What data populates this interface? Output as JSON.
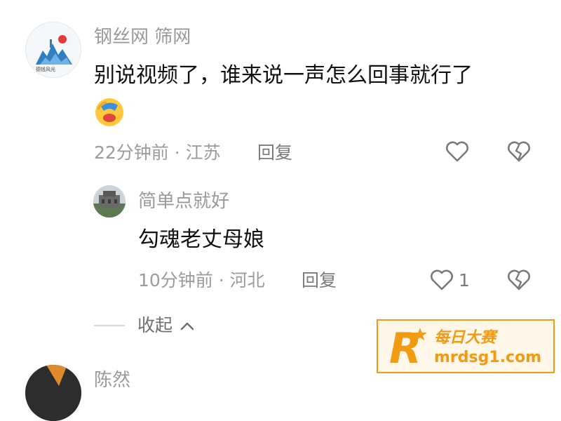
{
  "comments": [
    {
      "author": "钢丝网 筛网",
      "avatar_icon": "landscape-logo-avatar",
      "avatar_caption": "德钱风光",
      "text": "别说视频了，谁来说一声怎么回事就行了",
      "emoji_icon": "face-palm-emoji-icon",
      "time": "22分钟前 · 江苏",
      "reply_label": "回复",
      "likes": "",
      "replies": [
        {
          "author": "简单点就好",
          "avatar_icon": "building-photo-avatar",
          "text": "勾魂老丈母娘",
          "time": "10分钟前 · 河北",
          "reply_label": "回复",
          "likes": "1"
        }
      ],
      "collapse_label": "收起"
    },
    {
      "author": "陈然",
      "avatar_icon": "photo-avatar"
    }
  ],
  "watermark": {
    "logo_letter": "R",
    "cn_text": "每日大赛",
    "url": "mrdsg1.com"
  },
  "colors": {
    "meta_gray": "#9c9c9c",
    "watermark_orange": "#f29a12"
  }
}
